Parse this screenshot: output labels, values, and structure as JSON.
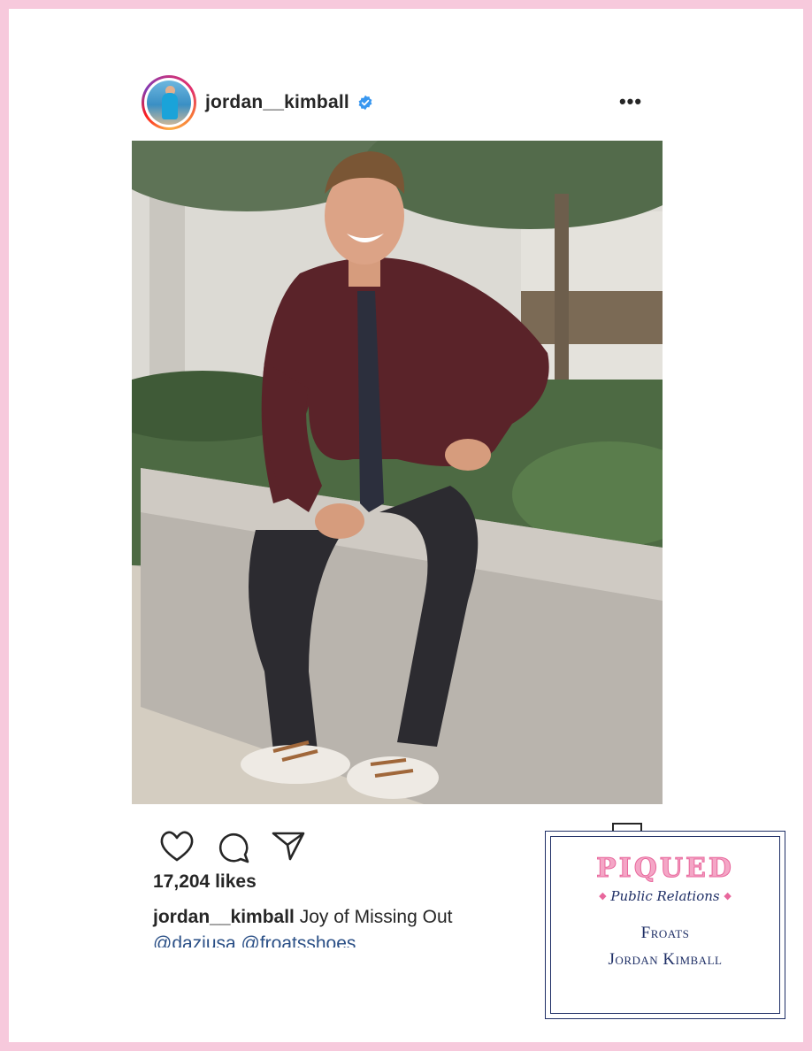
{
  "post": {
    "username": "jordan__kimball",
    "verified": true,
    "more_label": "•••",
    "likes": "17,204 likes",
    "caption_user": "jordan__kimball",
    "caption_text": "Joy of Missing Out",
    "mentions": "@daziusa @froatsshoes"
  },
  "stamp": {
    "brand": "PIQUED",
    "subtitle": "Public Relations",
    "line1": "Froats",
    "line2": "Jordan Kimball"
  },
  "icons": {
    "like": "heart-icon",
    "comment": "comment-icon",
    "share": "send-icon",
    "save": "bookmark-icon",
    "more": "more-icon",
    "verified": "verified-badge-icon"
  },
  "colors": {
    "frame": "#f7c9dc",
    "verified": "#3897f0",
    "mention": "#2a4f86",
    "stamp_navy": "#1f2f66",
    "stamp_pink": "#e8679c"
  }
}
